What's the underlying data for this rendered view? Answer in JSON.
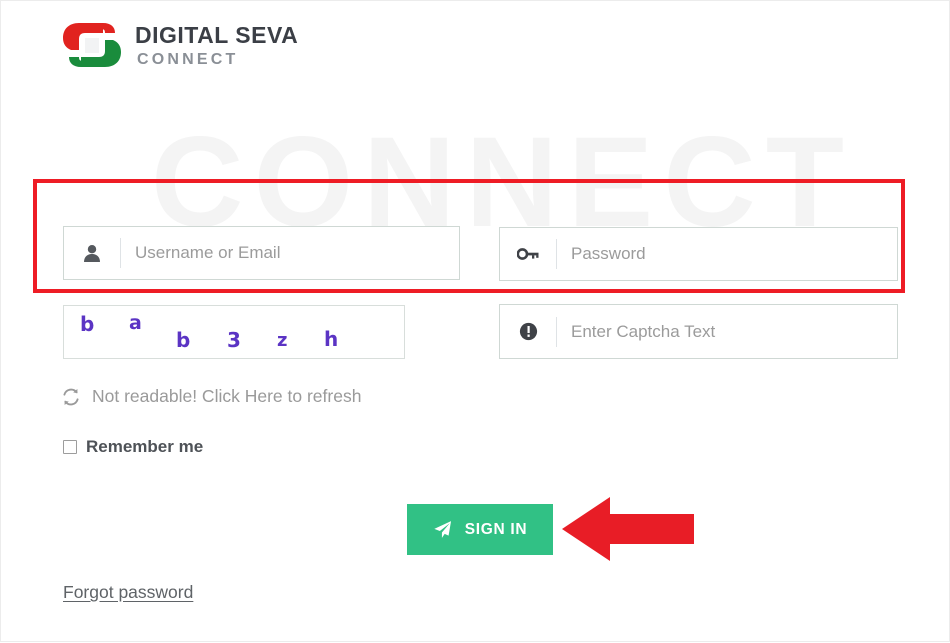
{
  "brand": {
    "primary": "DIGITAL SEVA",
    "secondary": "CONNECT",
    "mark_icon": "digital-seva-logo-mark",
    "colors": {
      "red": "#e1231f",
      "green": "#1a8c3c",
      "text": "#3b3f46"
    }
  },
  "watermark": {
    "text": "CONNECT",
    "color": "#f4f4f4"
  },
  "form": {
    "username": {
      "placeholder": "Username or Email",
      "value": "",
      "icon": "user-icon"
    },
    "password": {
      "placeholder": "Password",
      "value": "",
      "icon": "key-icon"
    },
    "captcha_input": {
      "placeholder": "Enter Captcha Text",
      "value": "",
      "icon": "exclamation-circle-icon"
    },
    "captcha_image": {
      "text": "bab3zh",
      "characters": [
        "b",
        "a",
        "b",
        "3",
        "z",
        "h"
      ],
      "color": "#5b34c4"
    },
    "refresh": {
      "label": "Not readable! Click Here to refresh",
      "icon": "refresh-icon"
    },
    "remember": {
      "label": "Remember me",
      "checked": false
    },
    "submit": {
      "label": "SIGN IN",
      "icon": "paper-plane-icon",
      "color": "#31c185"
    },
    "forgot": {
      "label": "Forgot password"
    }
  },
  "annotations": {
    "highlight_box": {
      "color": "#ee1c25",
      "target": "credentials-row"
    },
    "arrow": {
      "color": "#e81d26",
      "direction": "left",
      "target": "sign-in-button"
    }
  }
}
